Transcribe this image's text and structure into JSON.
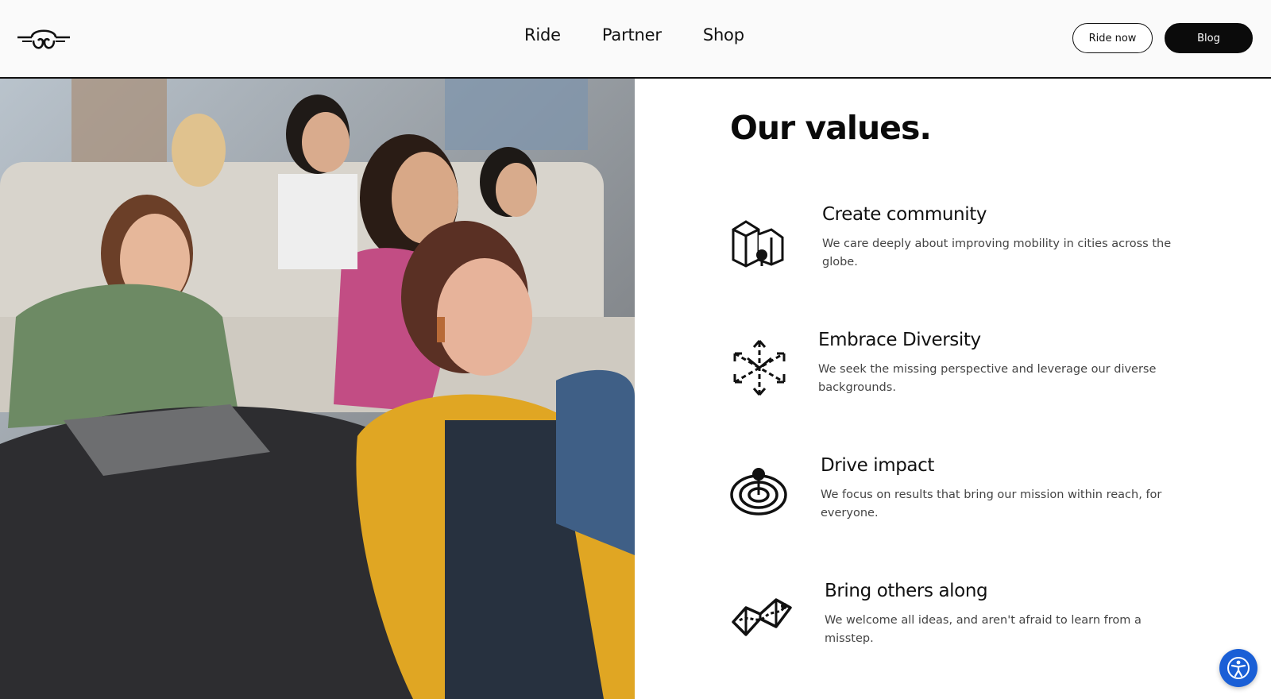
{
  "header": {
    "logo_icon": "bird-logo-icon",
    "nav": [
      {
        "label": "Ride"
      },
      {
        "label": "Partner"
      },
      {
        "label": "Shop"
      }
    ],
    "ride_now_label": "Ride now",
    "blog_label": "Blog"
  },
  "photo": {
    "alt": ""
  },
  "values": {
    "title": "Our values.",
    "items": [
      {
        "icon": "buildings-community-icon",
        "heading": "Create community",
        "text": "We care deeply about improving mobility in cities across the globe."
      },
      {
        "icon": "diversity-arrows-icon",
        "heading": "Embrace Diversity",
        "text": "We seek the missing perspective and leverage our diverse backgrounds."
      },
      {
        "icon": "target-pin-icon",
        "heading": "Drive impact",
        "text": "We focus on results that bring our mission within reach, for everyone."
      },
      {
        "icon": "map-route-icon",
        "heading": "Bring others along",
        "text": "We welcome all ideas, and aren't afraid to learn from a misstep."
      }
    ]
  },
  "accessibility": {
    "icon": "accessibility-person-icon",
    "color": "#1a5fd6"
  }
}
